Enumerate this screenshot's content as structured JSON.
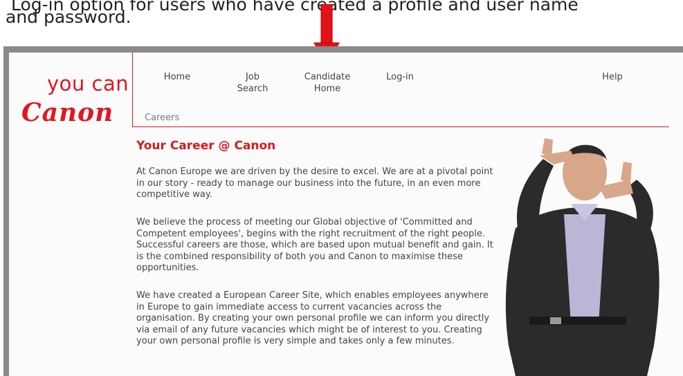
{
  "caption": {
    "line1": "Log-in option for users who have created a profile and user name",
    "line2": "and password."
  },
  "brand": {
    "tagline": "you can",
    "name": "Canon",
    "accent": "#e0171f"
  },
  "nav": {
    "home": "Home",
    "job_search_1": "Job",
    "job_search_2": "Search",
    "candidate_home_1": "Candidate",
    "candidate_home_2": "Home",
    "login": "Log-in",
    "help": "Help"
  },
  "breadcrumb": "Careers",
  "main": {
    "heading": "Your Career @ Canon",
    "paragraphs": [
      "At Canon Europe we are driven by the desire to excel. We are at a pivotal point in our story - ready to manage our business into the future, in an even more competitive way.",
      "We believe the process of meeting our Global objective of 'Committed and Competent employees', begins with the right recruitment of the right people. Successful careers are those, which are based upon mutual benefit and gain. It is the combined responsibility of both you and Canon to maximise these opportunities.",
      "We have created a European Career Site, which enables employees anywhere in Europe to gain immediate access to current vacancies across the organisation. By creating your own personal profile we can inform you directly via email of any future vacancies which might be of interest to you. Creating your own personal profile is very simple and takes only a few minutes."
    ]
  },
  "icons": {
    "arrow": "red-down-arrow-icon",
    "photo": "person-framing-hands-image"
  }
}
